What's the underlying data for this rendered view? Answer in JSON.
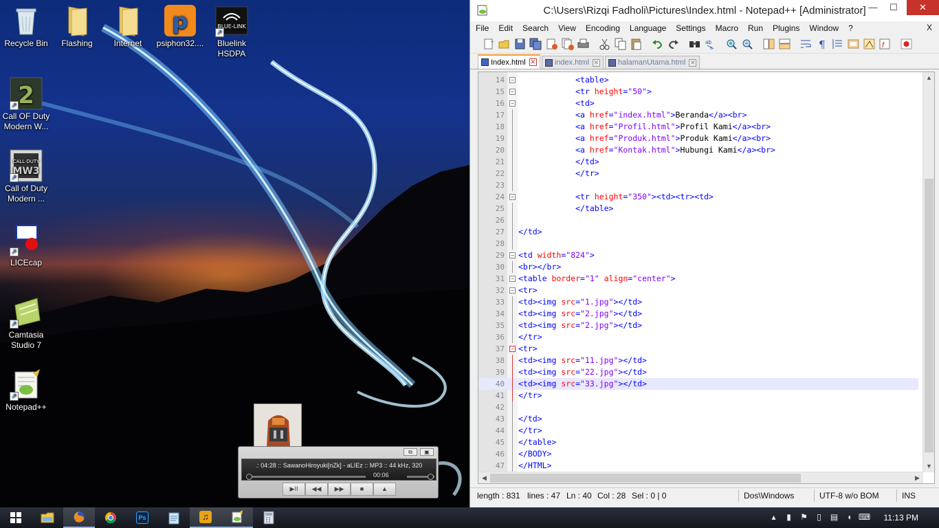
{
  "desktop": {
    "icons": [
      {
        "label": "Recycle Bin",
        "icon": "recycle-bin-icon",
        "shortcut": false
      },
      {
        "label": "Flashing",
        "icon": "folder-icon",
        "shortcut": false
      },
      {
        "label": "Internet",
        "icon": "folder-icon",
        "shortcut": false
      },
      {
        "label": "psiphon32....",
        "icon": "psiphon-icon",
        "shortcut": false
      },
      {
        "label": "Bluelink HSDPA",
        "icon": "bluelink-icon",
        "shortcut": true
      },
      {
        "label": "Call OF Duty Modern W...",
        "icon": "cod-mw2-icon",
        "shortcut": true
      },
      {
        "label": "Call of Duty Modern ...",
        "icon": "cod-mw3-icon",
        "shortcut": true
      },
      {
        "label": "LICEcap",
        "icon": "licecap-icon",
        "shortcut": true
      },
      {
        "label": "Camtasia Studio 7",
        "icon": "camtasia-icon",
        "shortcut": true
      },
      {
        "label": "Notepad++",
        "icon": "notepadpp-icon",
        "shortcut": true
      }
    ]
  },
  "player": {
    "track_text": ".: 04:28 :: SawanoHiroyuki[nZk] - aLIEz :: MP3 :: 44 kHz, 320",
    "time": "00:06",
    "seek_progress": 0.0,
    "volume_level": 0.85,
    "buttons": [
      "▶II",
      "◀◀",
      "▶▶",
      "■",
      "▲"
    ]
  },
  "window": {
    "title": "C:\\Users\\Rizqi Fadholi\\Pictures\\Index.html - Notepad++ [Administrator]",
    "controls": {
      "minimize": "—",
      "maximize": "☐",
      "close": "✕"
    },
    "menu": [
      "File",
      "Edit",
      "Search",
      "View",
      "Encoding",
      "Language",
      "Settings",
      "Macro",
      "Run",
      "Plugins",
      "Window",
      "?"
    ],
    "menu_close": "X",
    "tabs": [
      {
        "label": "Index.html",
        "active": true
      },
      {
        "label": "index.html",
        "active": false
      },
      {
        "label": "halamanUtama.html",
        "active": false
      }
    ]
  },
  "editor": {
    "current_line": 40,
    "lines": [
      {
        "n": 14,
        "fold": "box",
        "segs": [
          [
            "sp",
            "            "
          ],
          [
            "tg",
            "<table>"
          ]
        ]
      },
      {
        "n": 15,
        "fold": "box",
        "segs": [
          [
            "sp",
            "            "
          ],
          [
            "tg",
            "<tr "
          ],
          [
            "at",
            "height"
          ],
          [
            "tg",
            "="
          ],
          [
            "av",
            "\"50\""
          ],
          [
            "tg",
            ">"
          ]
        ]
      },
      {
        "n": 16,
        "fold": "box",
        "segs": [
          [
            "sp",
            "            "
          ],
          [
            "tg",
            "<td>"
          ]
        ]
      },
      {
        "n": 17,
        "fold": "line",
        "segs": [
          [
            "sp",
            "            "
          ],
          [
            "tg",
            "<a "
          ],
          [
            "at",
            "href"
          ],
          [
            "tg",
            "="
          ],
          [
            "av",
            "\"index.html\""
          ],
          [
            "tg",
            ">"
          ],
          [
            "tx",
            "Beranda"
          ],
          [
            "tg",
            "</a><br>"
          ]
        ]
      },
      {
        "n": 18,
        "fold": "line",
        "segs": [
          [
            "sp",
            "            "
          ],
          [
            "tg",
            "<a "
          ],
          [
            "at",
            "href"
          ],
          [
            "tg",
            "="
          ],
          [
            "av",
            "\"Profil.html\""
          ],
          [
            "tg",
            ">"
          ],
          [
            "tx",
            "Profil Kami"
          ],
          [
            "tg",
            "</a><br>"
          ]
        ]
      },
      {
        "n": 19,
        "fold": "line",
        "segs": [
          [
            "sp",
            "            "
          ],
          [
            "tg",
            "<a "
          ],
          [
            "at",
            "href"
          ],
          [
            "tg",
            "="
          ],
          [
            "av",
            "\"Produk.html\""
          ],
          [
            "tg",
            ">"
          ],
          [
            "tx",
            "Produk Kami"
          ],
          [
            "tg",
            "</a><br>"
          ]
        ]
      },
      {
        "n": 20,
        "fold": "line",
        "segs": [
          [
            "sp",
            "            "
          ],
          [
            "tg",
            "<a "
          ],
          [
            "at",
            "href"
          ],
          [
            "tg",
            "="
          ],
          [
            "av",
            "\"Kontak.html\""
          ],
          [
            "tg",
            ">"
          ],
          [
            "tx",
            "Hubungi Kami"
          ],
          [
            "tg",
            "</a><br>"
          ]
        ]
      },
      {
        "n": 21,
        "fold": "line",
        "segs": [
          [
            "sp",
            "            "
          ],
          [
            "tg",
            "</td>"
          ]
        ]
      },
      {
        "n": 22,
        "fold": "line",
        "segs": [
          [
            "sp",
            "            "
          ],
          [
            "tg",
            "</tr>"
          ]
        ]
      },
      {
        "n": 23,
        "fold": "line",
        "segs": []
      },
      {
        "n": 24,
        "fold": "box",
        "segs": [
          [
            "sp",
            "            "
          ],
          [
            "tg",
            "<tr "
          ],
          [
            "at",
            "height"
          ],
          [
            "tg",
            "="
          ],
          [
            "av",
            "\"350\""
          ],
          [
            "tg",
            "><td><tr><td>"
          ]
        ]
      },
      {
        "n": 25,
        "fold": "line",
        "segs": [
          [
            "sp",
            "            "
          ],
          [
            "tg",
            "</table>"
          ]
        ]
      },
      {
        "n": 26,
        "fold": "line",
        "segs": []
      },
      {
        "n": 27,
        "fold": "line",
        "segs": [
          [
            "tg",
            "</td>"
          ]
        ]
      },
      {
        "n": 28,
        "fold": "line",
        "segs": []
      },
      {
        "n": 29,
        "fold": "box",
        "segs": [
          [
            "tg",
            "<td "
          ],
          [
            "at",
            "width"
          ],
          [
            "tg",
            "="
          ],
          [
            "av",
            "\"824\""
          ],
          [
            "tg",
            ">"
          ]
        ]
      },
      {
        "n": 30,
        "fold": "line",
        "segs": [
          [
            "tg",
            "<br></br>"
          ]
        ]
      },
      {
        "n": 31,
        "fold": "box",
        "segs": [
          [
            "tg",
            "<table "
          ],
          [
            "at",
            "border"
          ],
          [
            "tg",
            "="
          ],
          [
            "av",
            "\"1\""
          ],
          [
            "tg",
            " "
          ],
          [
            "at",
            "align"
          ],
          [
            "tg",
            "="
          ],
          [
            "av",
            "\"center\""
          ],
          [
            "tg",
            ">"
          ]
        ]
      },
      {
        "n": 32,
        "fold": "box",
        "segs": [
          [
            "tg",
            "<tr>"
          ]
        ]
      },
      {
        "n": 33,
        "fold": "line",
        "segs": [
          [
            "tg",
            "<td><img "
          ],
          [
            "at",
            "src"
          ],
          [
            "tg",
            "="
          ],
          [
            "av",
            "\"1.jpg\""
          ],
          [
            "tg",
            "></td>"
          ]
        ]
      },
      {
        "n": 34,
        "fold": "line",
        "segs": [
          [
            "tg",
            "<td><img "
          ],
          [
            "at",
            "src"
          ],
          [
            "tg",
            "="
          ],
          [
            "av",
            "\"2.jpg\""
          ],
          [
            "tg",
            "></td>"
          ]
        ]
      },
      {
        "n": 35,
        "fold": "line",
        "segs": [
          [
            "tg",
            "<td><img "
          ],
          [
            "at",
            "src"
          ],
          [
            "tg",
            "="
          ],
          [
            "av",
            "\"2.jpg\""
          ],
          [
            "tg",
            "></td>"
          ]
        ]
      },
      {
        "n": 36,
        "fold": "line",
        "segs": [
          [
            "tg",
            "</tr>"
          ]
        ]
      },
      {
        "n": 37,
        "fold": "boxred",
        "segs": [
          [
            "tg",
            "<tr>"
          ]
        ]
      },
      {
        "n": 38,
        "fold": "linered",
        "segs": [
          [
            "tg",
            "<td><img "
          ],
          [
            "at",
            "src"
          ],
          [
            "tg",
            "="
          ],
          [
            "av",
            "\"11.jpg\""
          ],
          [
            "tg",
            "></td>"
          ]
        ]
      },
      {
        "n": 39,
        "fold": "linered",
        "segs": [
          [
            "tg",
            "<td><img "
          ],
          [
            "at",
            "src"
          ],
          [
            "tg",
            "="
          ],
          [
            "av",
            "\"22.jpg\""
          ],
          [
            "tg",
            "></td>"
          ]
        ]
      },
      {
        "n": 40,
        "fold": "linered",
        "segs": [
          [
            "tg",
            "<td><img "
          ],
          [
            "at",
            "src"
          ],
          [
            "tg",
            "="
          ],
          [
            "av",
            "\"33.jpg\""
          ],
          [
            "tg",
            "></td>"
          ]
        ]
      },
      {
        "n": 41,
        "fold": "linered",
        "segs": [
          [
            "tg",
            "</tr>"
          ]
        ]
      },
      {
        "n": 42,
        "fold": "line",
        "segs": []
      },
      {
        "n": 43,
        "fold": "line",
        "segs": [
          [
            "tg",
            "</td>"
          ]
        ]
      },
      {
        "n": 44,
        "fold": "line",
        "segs": [
          [
            "tg",
            "</tr>"
          ]
        ]
      },
      {
        "n": 45,
        "fold": "line",
        "segs": [
          [
            "tg",
            "</table>"
          ]
        ]
      },
      {
        "n": 46,
        "fold": "line",
        "segs": [
          [
            "tg",
            "</BODY>"
          ]
        ]
      },
      {
        "n": 47,
        "fold": "line",
        "segs": [
          [
            "tg",
            "</HTML>"
          ]
        ]
      }
    ]
  },
  "status": {
    "length": "length : 831",
    "lines": "lines : 47",
    "ln": "Ln : 40",
    "col": "Col : 28",
    "sel": "Sel : 0 | 0",
    "eol": "Dos\\Windows",
    "encoding": "UTF-8 w/o BOM",
    "mode": "INS"
  },
  "taskbar": {
    "clock": "11:13 PM",
    "apps": [
      "start-icon",
      "file-explorer-icon",
      "firefox-icon",
      "chrome-icon",
      "photoshop-icon",
      "notepad-icon",
      "winamp-icon",
      "notepadpp-icon",
      "calculator-icon"
    ],
    "photoshop_label": "Ps"
  },
  "colors": {
    "tag": "#0000ff",
    "attr": "#ff0000",
    "value": "#8000ff",
    "current_line": "#e8e8ff",
    "close_button": "#c7322a"
  }
}
